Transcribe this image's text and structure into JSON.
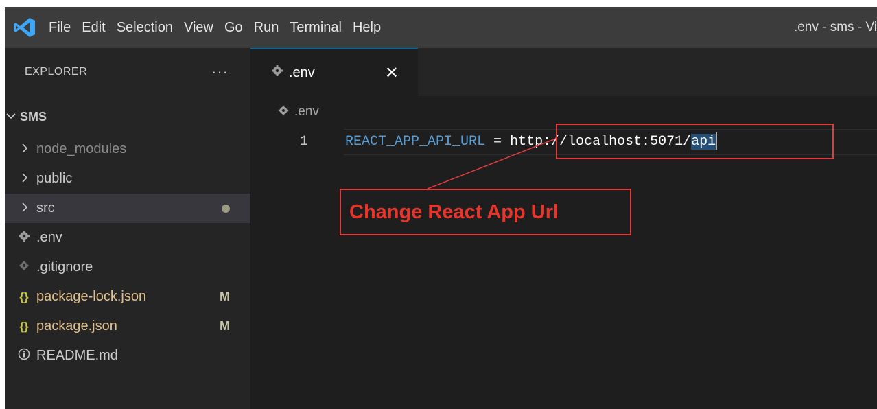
{
  "titlebar": {
    "menu": [
      "File",
      "Edit",
      "Selection",
      "View",
      "Go",
      "Run",
      "Terminal",
      "Help"
    ],
    "window_title": ".env - sms - Vi"
  },
  "sidebar": {
    "header": "EXPLORER",
    "more": "···",
    "folder": "SMS",
    "items": [
      {
        "label": "node_modules",
        "type": "folder",
        "icon": "chevron-right-icon",
        "color": "#8b8b8b"
      },
      {
        "label": "public",
        "type": "folder",
        "icon": "chevron-right-icon",
        "color": "#cccccc"
      },
      {
        "label": "src",
        "type": "folder",
        "icon": "chevron-right-icon",
        "color": "#cccccc",
        "modified_dot": true
      },
      {
        "label": ".env",
        "type": "file",
        "icon": "gear-icon",
        "color": "#cccccc"
      },
      {
        "label": ".gitignore",
        "type": "file",
        "icon": "git-diamond-icon",
        "color": "#cccccc"
      },
      {
        "label": "package-lock.json",
        "type": "file",
        "icon": "json-braces-icon",
        "color": "#e2c08d",
        "badge": "M"
      },
      {
        "label": "package.json",
        "type": "file",
        "icon": "json-braces-icon",
        "color": "#e2c08d",
        "badge": "M"
      },
      {
        "label": "README.md",
        "type": "file",
        "icon": "info-icon",
        "color": "#cccccc"
      }
    ]
  },
  "editor": {
    "tab_label": ".env",
    "tab_close": "✕",
    "breadcrumb": ".env",
    "line_number": "1",
    "code": {
      "variable": "REACT_APP_API_URL",
      "operator": " = ",
      "value_plain": "http://localhost:5071/",
      "value_selected": "api"
    }
  },
  "annotation": {
    "callout_text": "Change React App Url",
    "color": "#e03c3c"
  }
}
